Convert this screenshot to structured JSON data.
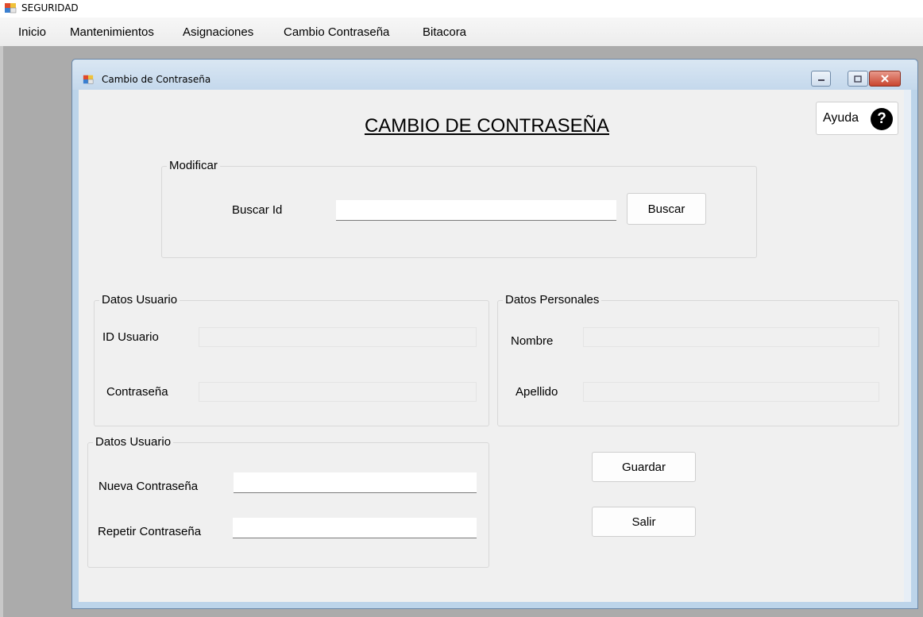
{
  "app": {
    "title": "SEGURIDAD",
    "icon": "app-form-icon"
  },
  "menu": {
    "items": [
      {
        "label": "Inicio"
      },
      {
        "label": "Mantenimientos"
      },
      {
        "label": "Asignaciones"
      },
      {
        "label": "Cambio Contraseña"
      },
      {
        "label": "Bitacora"
      }
    ]
  },
  "window": {
    "title": "Cambio de Contraseña",
    "icon": "form-icon",
    "controls": [
      "minimize-icon",
      "maximize-icon",
      "close-icon"
    ]
  },
  "form": {
    "heading": "CAMBIO DE CONTRASEÑA",
    "help": {
      "label": "Ayuda",
      "icon_glyph": "?"
    },
    "search_group": {
      "legend": "Modificar",
      "label": "Buscar Id",
      "value": "",
      "button": "Buscar"
    },
    "user_group": {
      "legend": "Datos Usuario",
      "id_label": "ID Usuario",
      "id_value": "",
      "password_label": "Contraseña",
      "password_value": ""
    },
    "personal_group": {
      "legend": "Datos Personales",
      "name_label": "Nombre",
      "name_value": "",
      "surname_label": "Apellido",
      "surname_value": ""
    },
    "new_password_group": {
      "legend": "Datos Usuario",
      "new_label": "Nueva Contraseña",
      "new_value": "",
      "repeat_label": "Repetir Contraseña",
      "repeat_value": ""
    },
    "buttons": {
      "save": "Guardar",
      "exit": "Salir"
    }
  },
  "colors": {
    "window_frame": "#bcd4ea",
    "client_bg": "#f0f0f0",
    "mdi_bg": "#ababab",
    "close_button": "#c9452f"
  }
}
